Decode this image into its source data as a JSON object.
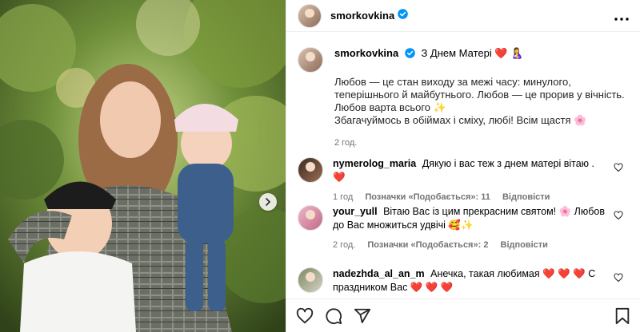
{
  "post": {
    "username": "smorkovkina",
    "caption": {
      "title_text": "З Днем Матері",
      "title_emoji": "❤️ 🤱",
      "lines": [
        "Любов — це стан виходу за межі часу: минулого,",
        "теперішнього й майбутнього. Любов — це прорив у вічність.",
        "Любов варта всього ✨",
        "Збагачуймось в обіймах і сміху, любі! Всім щастя 🌸"
      ],
      "time": "2 год."
    }
  },
  "comments": [
    {
      "username": "nymerolog_maria",
      "text": "Дякую і вас теж з днем матері вітаю .",
      "emoji": "❤️",
      "time": "1 год",
      "likes": "Позначки «Подобається»: 11",
      "reply": "Відповісти"
    },
    {
      "username": "your_yull",
      "text": "Вітаю Вас із цим прекрасним святом! 🌸 Любов до Вас множиться удвічі 🥰✨",
      "time": "2 год.",
      "likes": "Позначки «Подобається»: 2",
      "reply": "Відповісти"
    },
    {
      "username": "nadezhda_al_an_m",
      "text": "Анечка, такая любимая ❤️ ❤️ ❤️ С праздником Вас ❤️ ❤️ ❤️"
    }
  ],
  "colors": {
    "verified": "#0095f6",
    "meta_gray": "#737373",
    "heart": "#e0245e"
  },
  "icons": [
    "verified-icon",
    "more-icon",
    "heart-icon",
    "comment-icon",
    "share-icon",
    "save-icon",
    "chevron-right-icon"
  ]
}
